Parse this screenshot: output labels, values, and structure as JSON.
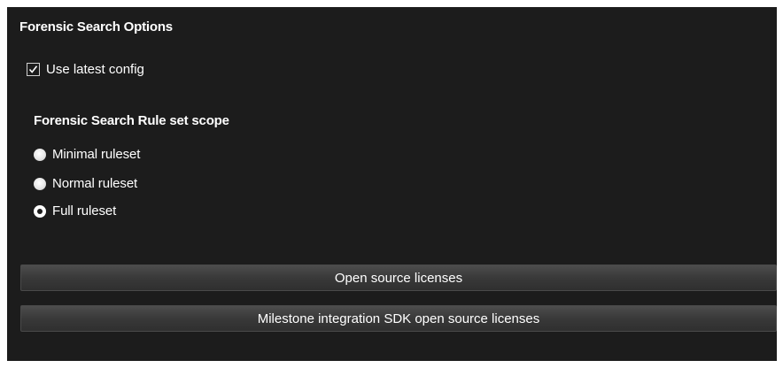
{
  "panel": {
    "title": "Forensic Search Options",
    "use_latest_config": {
      "label": "Use latest config",
      "checked": true
    },
    "ruleset_scope": {
      "title": "Forensic Search Rule set scope",
      "options": [
        {
          "label": "Minimal ruleset",
          "selected": false
        },
        {
          "label": "Normal ruleset",
          "selected": false
        },
        {
          "label": "Full ruleset",
          "selected": true
        }
      ]
    },
    "buttons": {
      "open_source_licenses": "Open source licenses",
      "milestone_sdk_licenses": "Milestone integration SDK open source licenses"
    }
  },
  "colors": {
    "panel_background": "#1c1c1c",
    "text": "#ffffff",
    "button_background": "#3a3a3a"
  }
}
